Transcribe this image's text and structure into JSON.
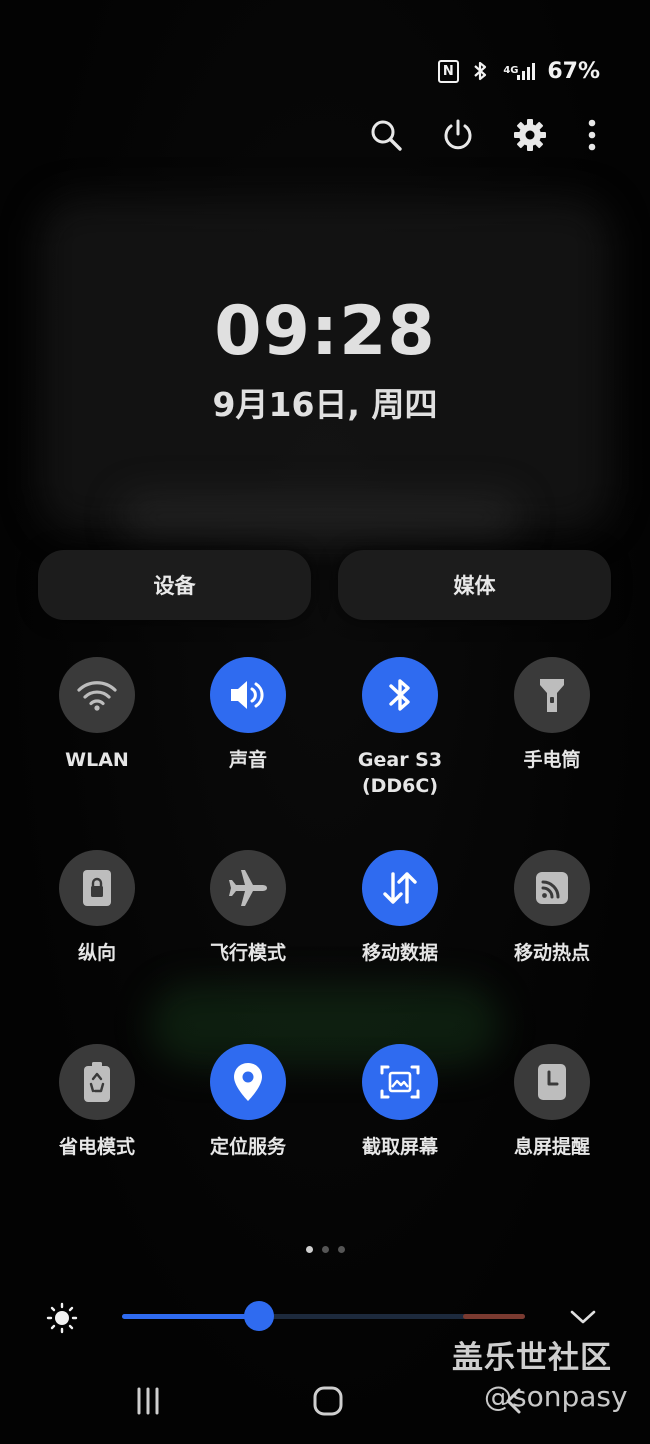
{
  "status_bar": {
    "nfc_label": "N",
    "network_type": "4G",
    "battery": "67%",
    "icons": [
      "nfc-icon",
      "bluetooth-icon",
      "signal-icon"
    ]
  },
  "toolbar": {
    "icons": [
      "search-icon",
      "power-icon",
      "settings-icon",
      "more-icon"
    ]
  },
  "clock": {
    "time": "09:28",
    "date": "9月16日, 周四"
  },
  "quick_buttons": {
    "devices_label": "设备",
    "media_label": "媒体"
  },
  "tiles": [
    {
      "label": "WLAN",
      "icon": "wifi-icon",
      "active": false
    },
    {
      "label": "声音",
      "icon": "sound-icon",
      "active": true
    },
    {
      "label": "Gear S3\n(DD6C)",
      "icon": "bluetooth-icon",
      "active": true
    },
    {
      "label": "手电筒",
      "icon": "flashlight-icon",
      "active": false
    },
    {
      "label": "纵向",
      "icon": "portrait-lock-icon",
      "active": false
    },
    {
      "label": "飞行模式",
      "icon": "airplane-icon",
      "active": false
    },
    {
      "label": "移动数据",
      "icon": "mobile-data-icon",
      "active": true
    },
    {
      "label": "移动热点",
      "icon": "hotspot-icon",
      "active": false
    },
    {
      "label": "省电模式",
      "icon": "battery-saver-icon",
      "active": false
    },
    {
      "label": "定位服务",
      "icon": "location-icon",
      "active": true
    },
    {
      "label": "截取屏幕",
      "icon": "screenshot-icon",
      "active": true
    },
    {
      "label": "息屏提醒",
      "icon": "always-on-display-icon",
      "active": false
    }
  ],
  "pagination": {
    "pages": 3,
    "current": 1
  },
  "brightness": {
    "level": 0.34
  },
  "colors": {
    "accent": "#2f6bf0",
    "tile_off": "#3a3a3a",
    "background": "#050505"
  },
  "watermark": {
    "line1": "盖乐世社区",
    "line2": "@sonpasy"
  }
}
